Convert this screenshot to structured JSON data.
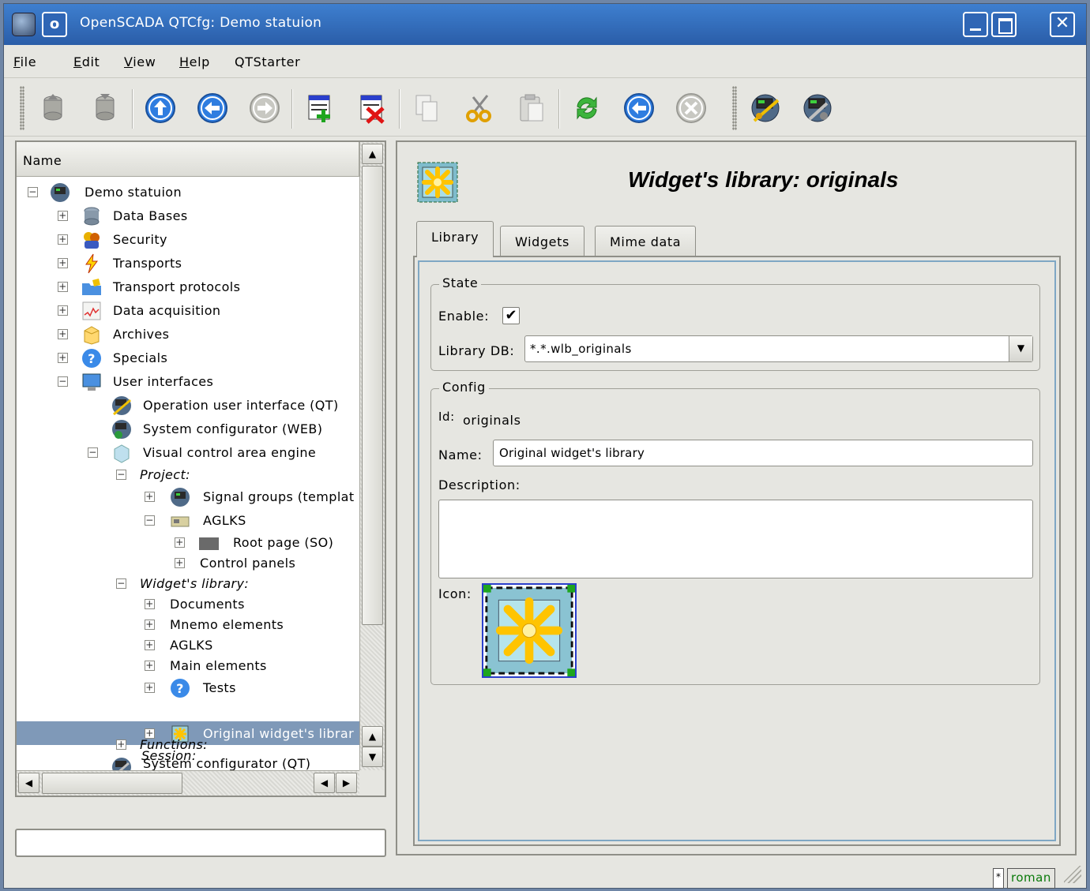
{
  "window": {
    "title": "OpenSCADA QTCfg: Demo statuion",
    "menu_button": "o"
  },
  "menu": [
    {
      "label": "File",
      "mnemonic": "F",
      "rest": "ile"
    },
    {
      "label": "Edit",
      "mnemonic": "E",
      "rest": "dit"
    },
    {
      "label": "View",
      "mnemonic": "V",
      "rest": "iew"
    },
    {
      "label": "Help",
      "mnemonic": "H",
      "rest": "elp"
    },
    {
      "label": "QTStarter",
      "mnemonic": "",
      "rest": "QTStarter"
    }
  ],
  "toolbar_icons": [
    "db-load-icon",
    "db-save-icon",
    "up-icon",
    "back-icon",
    "forward-icon",
    "add-item-icon",
    "delete-item-icon",
    "copy-icon",
    "cut-icon",
    "paste-icon",
    "refresh-icon",
    "start-icon",
    "stop-icon",
    "vision-icon",
    "configurator-icon"
  ],
  "tree": {
    "header": "Name",
    "nodes": [
      {
        "label": "Demo statuion",
        "icon": "station-icon"
      },
      {
        "label": "Data Bases",
        "icon": "database-icon"
      },
      {
        "label": "Security",
        "icon": "security-icon"
      },
      {
        "label": "Transports",
        "icon": "lightning-icon"
      },
      {
        "label": "Transport protocols",
        "icon": "folder-icon"
      },
      {
        "label": "Data acquisition",
        "icon": "graph-icon"
      },
      {
        "label": "Archives",
        "icon": "archive-icon"
      },
      {
        "label": "Specials",
        "icon": "help-icon"
      },
      {
        "label": "User interfaces",
        "icon": "monitor-icon"
      },
      {
        "label": "Operation user interface (QT)",
        "icon": "vision-icon"
      },
      {
        "label": "System configurator (WEB)",
        "icon": "web-config-icon"
      },
      {
        "label": "Visual control area engine",
        "icon": "engine-icon"
      },
      {
        "label": "Project:",
        "icon": ""
      },
      {
        "label": "Signal groups (templat",
        "icon": "station-icon"
      },
      {
        "label": "AGLKS",
        "icon": "project-icon"
      },
      {
        "label": "Root page (SO)",
        "icon": "page-icon"
      },
      {
        "label": "Control panels",
        "icon": ""
      },
      {
        "label": "Widget's library:",
        "icon": ""
      },
      {
        "label": "Documents",
        "icon": ""
      },
      {
        "label": "Mnemo elements",
        "icon": ""
      },
      {
        "label": "AGLKS",
        "icon": ""
      },
      {
        "label": "Main elements",
        "icon": ""
      },
      {
        "label": "Tests",
        "icon": "help-icon"
      },
      {
        "label": "Original widget's librar",
        "icon": "widget-library-icon"
      },
      {
        "label": "Session:",
        "icon": ""
      },
      {
        "label": "Functions:",
        "icon": ""
      },
      {
        "label": "System configurator (QT)",
        "icon": "configurator-icon"
      }
    ],
    "selected": "Original widget's librar"
  },
  "page": {
    "title": "Widget's library: originals",
    "tabs": [
      "Library",
      "Widgets",
      "Mime data"
    ],
    "active_tab": "Library",
    "state": {
      "legend": "State",
      "enable_label": "Enable:",
      "enable_checked": true,
      "library_db_label": "Library DB:",
      "library_db_value": "*.*.wlb_originals"
    },
    "config": {
      "legend": "Config",
      "id_label": "Id:",
      "id_value": "originals",
      "name_label": "Name:",
      "name_value": "Original widget's library",
      "description_label": "Description:",
      "description_value": "",
      "icon_label": "Icon:"
    }
  },
  "status": {
    "modified_marker": "*",
    "user": "roman"
  }
}
